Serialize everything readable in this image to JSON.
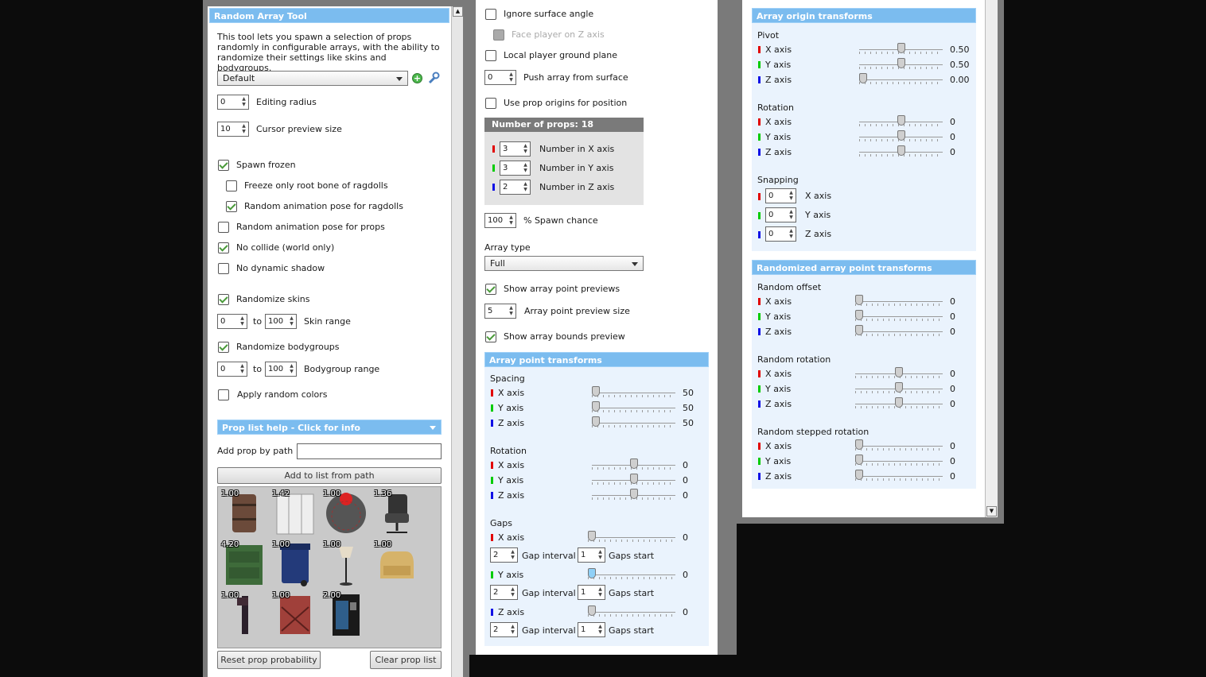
{
  "left": {
    "title": "Random Array Tool",
    "description": "This tool lets you spawn a selection of props randomly in configurable arrays, with the ability to randomize their settings like skins and bodygroups.",
    "preset": "Default",
    "editing_radius": {
      "value": "0",
      "label": "Editing radius"
    },
    "cursor_preview": {
      "value": "10",
      "label": "Cursor preview size"
    },
    "checks": {
      "spawn_frozen": "Spawn frozen",
      "freeze_root": "Freeze only root bone of ragdolls",
      "random_anim_ragdolls": "Random animation pose for ragdolls",
      "random_anim_props": "Random animation pose for props",
      "no_collide": "No collide (world only)",
      "no_shadow": "No dynamic shadow",
      "rand_skins": "Randomize skins",
      "rand_bodygroups": "Randomize bodygroups",
      "rand_colors": "Apply random colors"
    },
    "skin_range": {
      "from": "0",
      "to_label": "to",
      "to": "100",
      "label": "Skin range"
    },
    "bodygroup_range": {
      "from": "0",
      "to_label": "to",
      "to": "100",
      "label": "Bodygroup range"
    },
    "prop_help": "Prop list help - Click for info",
    "add_by_path_label": "Add prop by path",
    "add_by_path_value": "",
    "add_button": "Add to list from path",
    "props": [
      "1.00",
      "1.42",
      "1.00",
      "1.36",
      "4.20",
      "1.00",
      "1.00",
      "1.00",
      "1.00",
      "1.00",
      "2.00"
    ],
    "reset_button": "Reset prop probability",
    "clear_button": "Clear prop list"
  },
  "middle": {
    "ignore_surface": "Ignore surface angle",
    "face_player": "Face player on Z axis",
    "local_ground": "Local player ground plane",
    "push": {
      "value": "0",
      "label": "Push array from surface"
    },
    "use_origins": "Use prop origins for position",
    "num_props_title": "Number of props: 18",
    "num_x": {
      "value": "3",
      "label": "Number in X axis"
    },
    "num_y": {
      "value": "3",
      "label": "Number in Y axis"
    },
    "num_z": {
      "value": "2",
      "label": "Number in Z axis"
    },
    "spawn_chance": {
      "value": "100",
      "label": "% Spawn chance"
    },
    "array_type_label": "Array type",
    "array_type": "Full",
    "show_previews": "Show array point previews",
    "preview_size": {
      "value": "5",
      "label": "Array point preview size"
    },
    "show_bounds": "Show array bounds preview",
    "apt_title": "Array point transforms",
    "spacing_label": "Spacing",
    "spacing": [
      {
        "axis": "X axis",
        "value": "50",
        "level": 0.0
      },
      {
        "axis": "Y axis",
        "value": "50",
        "level": 0.0
      },
      {
        "axis": "Z axis",
        "value": "50",
        "level": 0.0
      }
    ],
    "rotation_label": "Rotation",
    "rotation": [
      {
        "axis": "X axis",
        "value": "0",
        "level": 0.5
      },
      {
        "axis": "Y axis",
        "value": "0",
        "level": 0.5
      },
      {
        "axis": "Z axis",
        "value": "0",
        "level": 0.5
      }
    ],
    "gaps_label": "Gaps",
    "gaps": [
      {
        "axis": "X axis",
        "value": "0",
        "interval": "2",
        "interval_label": "Gap interval",
        "start": "1",
        "start_label": "Gaps start"
      },
      {
        "axis": "Y axis",
        "value": "0",
        "interval": "2",
        "interval_label": "Gap interval",
        "start": "1",
        "start_label": "Gaps start"
      },
      {
        "axis": "Z axis",
        "value": "0",
        "interval": "2",
        "interval_label": "Gap interval",
        "start": "1",
        "start_label": "Gaps start"
      }
    ]
  },
  "right": {
    "aot_title": "Array origin transforms",
    "pivot_label": "Pivot",
    "pivot": [
      {
        "axis": "X axis",
        "value": "0.50",
        "level": 0.5
      },
      {
        "axis": "Y axis",
        "value": "0.50",
        "level": 0.5
      },
      {
        "axis": "Z axis",
        "value": "0.00",
        "level": 0.0
      }
    ],
    "rotation_label": "Rotation",
    "rotation": [
      {
        "axis": "X axis",
        "value": "0",
        "level": 0.5
      },
      {
        "axis": "Y axis",
        "value": "0",
        "level": 0.5
      },
      {
        "axis": "Z axis",
        "value": "0",
        "level": 0.5
      }
    ],
    "snapping_label": "Snapping",
    "snapping": [
      {
        "axis": "X axis",
        "value": "0"
      },
      {
        "axis": "Y axis",
        "value": "0"
      },
      {
        "axis": "Z axis",
        "value": "0"
      }
    ],
    "rapt_title": "Randomized array point transforms",
    "offset_label": "Random offset",
    "offset": [
      {
        "axis": "X axis",
        "value": "0",
        "level": 0.0
      },
      {
        "axis": "Y axis",
        "value": "0",
        "level": 0.0
      },
      {
        "axis": "Z axis",
        "value": "0",
        "level": 0.0
      }
    ],
    "rrot_label": "Random rotation",
    "rrot": [
      {
        "axis": "X axis",
        "value": "0",
        "level": 0.5
      },
      {
        "axis": "Y axis",
        "value": "0",
        "level": 0.5
      },
      {
        "axis": "Z axis",
        "value": "0",
        "level": 0.5
      }
    ],
    "rstep_label": "Random stepped rotation",
    "rstep": [
      {
        "axis": "X axis",
        "value": "0",
        "level": 0.0
      },
      {
        "axis": "Y axis",
        "value": "0",
        "level": 0.0
      },
      {
        "axis": "Z axis",
        "value": "0",
        "level": 0.0
      }
    ]
  },
  "colors": {
    "header": "#7bbcef",
    "x_axis": "#e10000",
    "y_axis": "#00cc00",
    "z_axis": "#1010e6"
  },
  "icons": [
    "add-preset-icon",
    "wrench-icon",
    "scroll-up-icon",
    "scroll-down-icon"
  ]
}
